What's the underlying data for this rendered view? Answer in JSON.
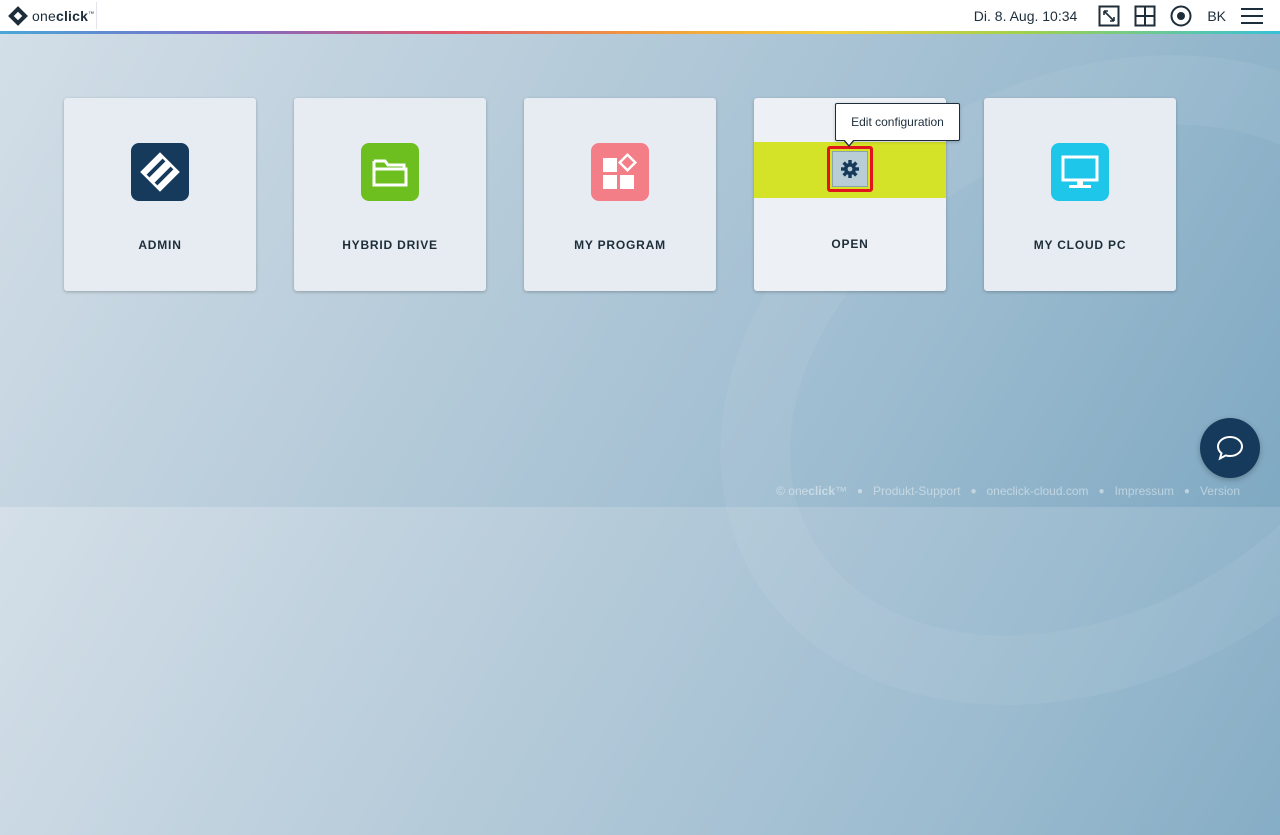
{
  "brand": {
    "name_light": "one",
    "name_bold": "click",
    "tm": "™"
  },
  "header": {
    "datetime": "Di. 8. Aug.  10:34",
    "initials": "BK",
    "icons": [
      "fullscreen-icon",
      "grid-icon",
      "record-icon",
      "hamburger-menu-icon"
    ]
  },
  "tiles": [
    {
      "label": "ADMIN",
      "icon": "admin-diamond-icon",
      "color": "#163a5c"
    },
    {
      "label": "HYBRID DRIVE",
      "icon": "folder-icon",
      "color": "#6cbf1f"
    },
    {
      "label": "MY PROGRAM",
      "icon": "program-blocks-icon",
      "color": "#f47e87"
    },
    {
      "label": "OPEN",
      "icon": "gear-icon",
      "color": "#d4e327"
    },
    {
      "label": "MY CLOUD PC",
      "icon": "monitor-icon",
      "color": "#1ec6ea"
    }
  ],
  "tooltip": {
    "text": "Edit configuration"
  },
  "footer": {
    "copyright_pre": "© one",
    "copyright_bold": "click",
    "copyright_tm": "™",
    "links": [
      "Produkt-Support",
      "oneclick-cloud.com",
      "Impressum",
      "Version"
    ]
  },
  "colors": {
    "highlight_border": "#e0141a",
    "band": "#d4e327",
    "chat": "#163a5c"
  }
}
